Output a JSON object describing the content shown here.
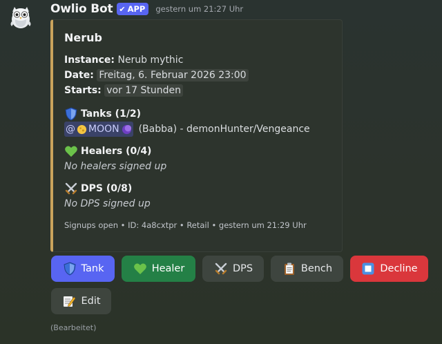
{
  "message": {
    "username": "Owlio Bot",
    "badge": "APP",
    "badge_icon": "checkmark-icon",
    "timestamp": "gestern um 21:27 Uhr",
    "edited_label": "(Bearbeitet)"
  },
  "embed": {
    "accent_color": "#c9a35c",
    "title": "Nerub",
    "instance_label": "Instance:",
    "instance_value": "Nerub mythic",
    "date_label": "Date:",
    "date_value": "Freitag, 6. Februar 2026 23:00",
    "starts_label": "Starts:",
    "starts_value": "vor 17 Stunden",
    "tanks": {
      "icon": "shield-icon",
      "title": "Tanks (1/2)",
      "mention_prefix": "@",
      "mention_name": "MOON",
      "detail": "(Babba) - demonHunter/Vengeance"
    },
    "healers": {
      "icon": "green-heart-icon",
      "title": "Healers (0/4)",
      "empty": "No healers signed up"
    },
    "dps": {
      "icon": "crossed-swords-icon",
      "title": "DPS (0/8)",
      "empty": "No DPS signed up"
    },
    "footer": "Signups open • ID: 4a8cxtpr • Retail • gestern um 21:29 Uhr"
  },
  "buttons": {
    "tank": {
      "label": "Tank",
      "icon": "shield-icon",
      "color": "#5865f2"
    },
    "healer": {
      "label": "Healer",
      "icon": "green-heart-icon",
      "color": "#248046"
    },
    "dps": {
      "label": "DPS",
      "icon": "crossed-swords-icon"
    },
    "bench": {
      "label": "Bench",
      "icon": "clipboard-icon"
    },
    "decline": {
      "label": "Decline",
      "icon": "stop-button-icon",
      "color": "#da373c"
    },
    "edit": {
      "label": "Edit",
      "icon": "memo-icon"
    }
  }
}
